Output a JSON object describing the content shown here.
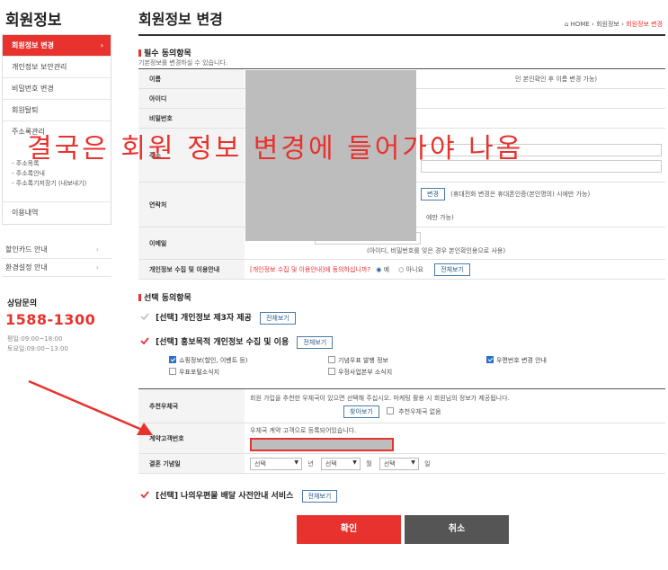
{
  "sidebar": {
    "title": "회원정보",
    "items": [
      {
        "label": "회원정보 변경"
      },
      {
        "label": "개인정보 보안관리"
      },
      {
        "label": "비밀번호 변경"
      },
      {
        "label": "회원탈퇴"
      },
      {
        "label": "주소록관리"
      }
    ],
    "sub_items": [
      {
        "label": "- 주소목록"
      },
      {
        "label": "- 주소록안내"
      },
      {
        "label": "- 주소록기저장기 (내보내기)"
      }
    ],
    "usage_label": "이용내역",
    "extra_items": [
      {
        "label": "할인카드 안내"
      },
      {
        "label": "환경설정 안내"
      }
    ],
    "consult": {
      "label": "상담문의",
      "phone": "1588-1300",
      "weekday": "평일:09:00~18:00",
      "saturday": "토요일:09:00~13:00"
    }
  },
  "header": {
    "title": "회원정보 변경",
    "breadcrumb": {
      "home": "HOME",
      "sep": "›",
      "mid": "회원정보",
      "current": "회원정보 변경"
    }
  },
  "required": {
    "title": "필수 동의항목",
    "desc": "기본정보를 변경하실 수 있습니다.",
    "rows": {
      "name": {
        "label": "이름",
        "note": "인 본인확인 후 이름 변경 가능)"
      },
      "id": {
        "label": "아이디"
      },
      "password": {
        "label": "비밀번호"
      },
      "address": {
        "label": "주소"
      },
      "contact": {
        "label": "연락처",
        "btn": "변경",
        "note": "(휴대전화 변경은 휴대폰인증(본인명의) 시에만 가능)",
        "note2": "에만 가능)"
      },
      "email": {
        "label": "이메일",
        "note": "(아이디, 비밀번호를 잊은 경우 본인확인용으로 사용)"
      },
      "consent": {
        "label": "개인정보 수집 및 이용안내",
        "question": "[개인정보 수집 및 이용안내]에 동의하십니까?",
        "yes": "예",
        "no": "아니요",
        "view": "전체보기"
      }
    }
  },
  "overlay_text": "결국은 회원 정보 변경에 들어가야 나옴",
  "optional": {
    "title": "선택 동의항목",
    "third_party": {
      "label": "[선택] 개인정보 제3자 제공",
      "view": "전체보기"
    },
    "marketing": {
      "label": "[선택] 홍보목적 개인정보 수집 및 이용",
      "view": "전체보기"
    },
    "checks": [
      {
        "label": "쇼핑정보(할인, 이벤트 등)",
        "checked": true
      },
      {
        "label": "기념우표 발행 정보",
        "checked": false
      },
      {
        "label": "우편번호 변경 안내",
        "checked": true
      },
      {
        "label": "우표포털소식지",
        "checked": false
      },
      {
        "label": "우정사업본부 소식지",
        "checked": false
      }
    ],
    "recommender": {
      "label": "추천우체국",
      "desc": "회원 가입을 추천한 우체국이 있으면 선택해 주십시오. 마케팅 활용 시 회원님의 정보가 제공됩니다.",
      "find": "찾아보기",
      "none": "추천우체국 없음"
    },
    "contract": {
      "label": "계약고객번호",
      "desc": "우체국 계약 고객으로 등록되어있습니다."
    },
    "anniversary": {
      "label": "결혼 기념일",
      "select": "선택",
      "year": "년",
      "month": "월",
      "day": "일"
    },
    "delivery": {
      "label": "[선택] 나의우편물 배달 사전안내 서비스",
      "view": "전체보기"
    }
  },
  "buttons": {
    "confirm": "확인",
    "cancel": "취소"
  },
  "colors": {
    "accent": "#e8322e",
    "blue": "#2a72c8"
  }
}
